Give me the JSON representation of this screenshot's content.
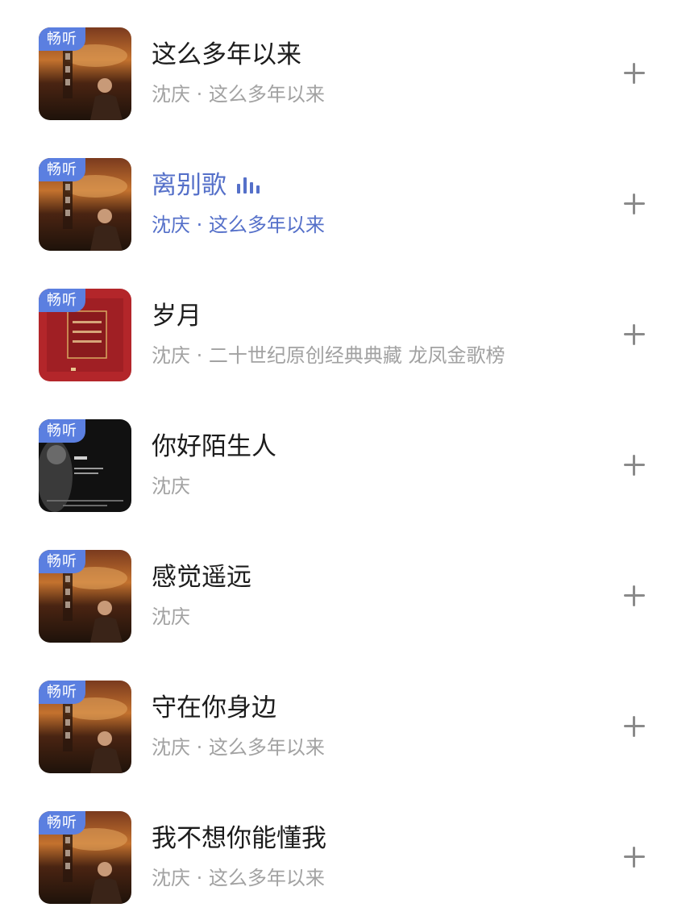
{
  "songs": [
    {
      "title": "这么多年以来",
      "subtitle": "沈庆 · 这么多年以来",
      "badge": "畅听",
      "cover": "album-this-many-years",
      "playing": false
    },
    {
      "title": "离别歌",
      "subtitle": "沈庆 · 这么多年以来",
      "badge": "畅听",
      "cover": "album-this-many-years",
      "playing": true
    },
    {
      "title": "岁月",
      "subtitle": "沈庆 · 二十世纪原创经典典藏 龙凤金歌榜",
      "badge": "畅听",
      "cover": "album-red-collection",
      "playing": false
    },
    {
      "title": "你好陌生人",
      "subtitle": "沈庆",
      "badge": "畅听",
      "cover": "album-dark-portrait",
      "playing": false
    },
    {
      "title": "感觉遥远",
      "subtitle": "沈庆",
      "badge": "畅听",
      "cover": "album-this-many-years",
      "playing": false
    },
    {
      "title": "守在你身边",
      "subtitle": "沈庆 · 这么多年以来",
      "badge": "畅听",
      "cover": "album-this-many-years",
      "playing": false
    },
    {
      "title": "我不想你能懂我",
      "subtitle": "沈庆 · 这么多年以来",
      "badge": "畅听",
      "cover": "album-this-many-years",
      "playing": false
    }
  ],
  "colors": {
    "badge": "#5b7fe0",
    "playing_text": "#5570c9",
    "title_text": "#1c1c1c",
    "subtitle_text": "#a2a2a2",
    "add_icon": "#8a8a8a"
  },
  "icons": {
    "add": "plus-icon",
    "playing": "equalizer-icon"
  }
}
